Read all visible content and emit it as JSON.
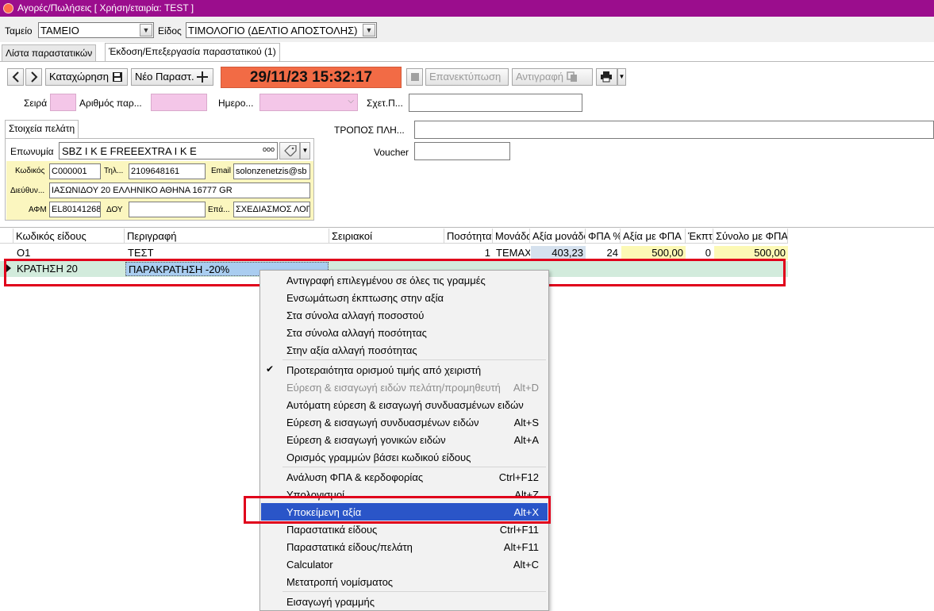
{
  "window": {
    "title": "Αγορές/Πωλήσεις  [ Χρήση/εταιρία: TEST ]"
  },
  "header": {
    "register_label": "Ταμείο",
    "register_value": "ΤΑΜΕΙΟ",
    "type_label": "Είδος",
    "type_value": "ΤΙΜΟΛΟΓΙΟ (ΔΕΛΤΙΟ ΑΠΟΣΤΟΛΗΣ)"
  },
  "tabs": [
    {
      "label": "Λίστα παραστατικών"
    },
    {
      "label": "Έκδοση/Επεξεργασία παραστατικού (1)"
    }
  ],
  "toolbar": {
    "save_label": "Καταχώρηση",
    "new_label": "Νέο Παραστ.",
    "datetime": "29/11/23 15:32:17",
    "reprint_label": "Επανεκτύπωση",
    "copy_label": "Αντιγραφή"
  },
  "doc_fields": {
    "series_label": "Σειρά",
    "number_label": "Αριθμός παρ...",
    "date_label": "Ημερο...",
    "related_label": "Σχετ.Π..."
  },
  "customer": {
    "tab_label": "Στοιχεία πελάτη",
    "name_label": "Επωνυμία",
    "name_value": "SBZ I K E  FREEEXTRA I K E",
    "ellipsis": "ooo",
    "code_label": "Κωδικός",
    "code_value": "C000001",
    "phone_label": "Τηλ...",
    "phone_value": "2109648161",
    "email_label": "Email",
    "email_value": "solonzenetzis@sb",
    "address_label": "Διεύθυν...",
    "address_value": "ΙΑΣΩΝΙΔΟΥ 20 ΕΛΛΗΝΙΚΟ ΑΘΗΝΑ 16777 GR",
    "afm_label": "ΑΦΜ",
    "afm_value": "EL80141268",
    "doy_label": "ΔΟΥ",
    "doy_value": "",
    "job_label": "Επά...",
    "job_value": "ΣΧΕΔΙΑΣΜΟΣ ΛΟΓ"
  },
  "payment": {
    "method_label": "ΤΡΟΠΟΣ ΠΛΗ...",
    "voucher_label": "Voucher"
  },
  "grid": {
    "columns": [
      "Κωδικός είδους",
      "Περιγραφή",
      "Σειριακοί",
      "Ποσότητα",
      "Μονάδα",
      "Αξία μονάδας",
      "ΦΠΑ %",
      "Αξία με ΦΠΑ",
      "Έκπτ",
      "Σύνολο με ΦΠΑ"
    ],
    "rows": [
      {
        "code": "O1",
        "desc": "ΤΕΣΤ",
        "serial": "",
        "qty": "1",
        "unit": "ΤΕΜΑΧ",
        "price": "403,23",
        "vat": "24",
        "price_vat": "500,00",
        "disc": "0",
        "total": "500,00"
      },
      {
        "code": "ΚΡΑΤΗΣΗ 20",
        "desc": "ΠΑΡΑΚΡΑΤΗΣΗ -20%",
        "serial": "",
        "qty": "",
        "unit": "",
        "price": "",
        "vat": "",
        "price_vat": "",
        "disc": "",
        "total": ""
      }
    ]
  },
  "context_menu": {
    "items": [
      {
        "label": "Αντιγραφή επιλεγμένου σε όλες τις γραμμές",
        "shortcut": ""
      },
      {
        "label": "Ενσωμάτωση έκπτωσης στην αξία",
        "shortcut": ""
      },
      {
        "label": "Στα σύνολα αλλαγή ποσοστού",
        "shortcut": ""
      },
      {
        "label": "Στα σύνολα αλλαγή ποσότητας",
        "shortcut": ""
      },
      {
        "label": "Στην αξία αλλαγή ποσότητας",
        "shortcut": ""
      },
      {
        "label": "Προτεραιότητα ορισμού τιμής από χειριστή",
        "shortcut": ""
      },
      {
        "label": "Εύρεση & εισαγωγή ειδών πελάτη/προμηθευτή",
        "shortcut": "Alt+D"
      },
      {
        "label": "Αυτόματη εύρεση & εισαγωγή συνδυασμένων ειδών",
        "shortcut": ""
      },
      {
        "label": "Εύρεση & εισαγωγή συνδυασμένων ειδών",
        "shortcut": "Alt+S"
      },
      {
        "label": "Εύρεση & εισαγωγή γονικών ειδών",
        "shortcut": "Alt+A"
      },
      {
        "label": "Ορισμός γραμμών βάσει κωδικού είδους",
        "shortcut": ""
      },
      {
        "label": "Ανάλυση ΦΠΑ & κερδοφορίας",
        "shortcut": "Ctrl+F12"
      },
      {
        "label": "Υπολογισμοί",
        "shortcut": "Alt+Z"
      },
      {
        "label": "Υποκείμενη αξία",
        "shortcut": "Alt+X"
      },
      {
        "label": "Παραστατικά είδους",
        "shortcut": "Ctrl+F11"
      },
      {
        "label": "Παραστατικά είδους/πελάτη",
        "shortcut": "Alt+F11"
      },
      {
        "label": "Calculator",
        "shortcut": "Alt+C"
      },
      {
        "label": "Μετατροπή νομίσματος",
        "shortcut": ""
      },
      {
        "label": "Εισαγωγή γραμμής",
        "shortcut": ""
      }
    ]
  },
  "colors": {
    "titlebar": "#9b0d8d",
    "datetime_bg": "#f26b45",
    "menu_highlight": "#2a55c8",
    "annotation_red": "#e0001b"
  }
}
